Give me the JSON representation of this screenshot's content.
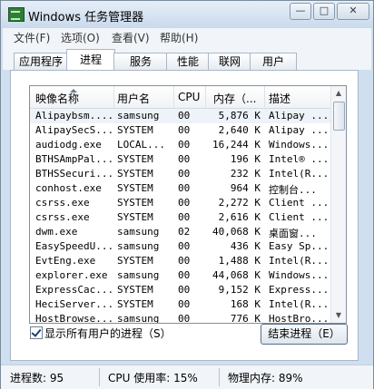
{
  "window": {
    "title": "Windows 任务管理器",
    "controls": {
      "minimize": "—",
      "maximize": "□",
      "close": "✕"
    }
  },
  "menu": [
    "文件(F)",
    "选项(O)",
    "查看(V)",
    "帮助(H)"
  ],
  "tabs": [
    {
      "label": "应用程序",
      "active": false
    },
    {
      "label": "进程",
      "active": true
    },
    {
      "label": "服务",
      "active": false
    },
    {
      "label": "性能",
      "active": false
    },
    {
      "label": "联网",
      "active": false
    },
    {
      "label": "用户",
      "active": false
    }
  ],
  "table": {
    "columns": [
      "映像名称",
      "用户名",
      "CPU",
      "内存（...",
      "描述"
    ],
    "rows": [
      [
        "Alipaybsm....",
        "samsung",
        "00",
        "5,876 K",
        "Alipay ..."
      ],
      [
        "AlipaySecS...",
        "SYSTEM",
        "00",
        "2,640 K",
        "Alipay ..."
      ],
      [
        "audiodg.exe",
        "LOCAL...",
        "00",
        "16,244 K",
        "Windows..."
      ],
      [
        "BTHSAmpPal...",
        "SYSTEM",
        "00",
        "196 K",
        "Intel® ..."
      ],
      [
        "BTHSSecuri...",
        "SYSTEM",
        "00",
        "232 K",
        "Intel(R..."
      ],
      [
        "conhost.exe",
        "SYSTEM",
        "00",
        "964 K",
        "控制台..."
      ],
      [
        "csrss.exe",
        "SYSTEM",
        "00",
        "2,272 K",
        "Client ..."
      ],
      [
        "csrss.exe",
        "SYSTEM",
        "00",
        "2,616 K",
        "Client ..."
      ],
      [
        "dwm.exe",
        "samsung",
        "02",
        "40,068 K",
        "桌面窗..."
      ],
      [
        "EasySpeedU...",
        "samsung",
        "00",
        "436 K",
        "Easy Sp..."
      ],
      [
        "EvtEng.exe",
        "SYSTEM",
        "00",
        "1,488 K",
        "Intel(R..."
      ],
      [
        "explorer.exe",
        "samsung",
        "00",
        "44,068 K",
        "Windows..."
      ],
      [
        "ExpressCac...",
        "SYSTEM",
        "00",
        "9,152 K",
        "Express..."
      ],
      [
        "HeciServer...",
        "SYSTEM",
        "00",
        "168 K",
        "Intel(R..."
      ],
      [
        "HostBrowse...",
        "samsung",
        "00",
        "776 K",
        "HostBro..."
      ]
    ]
  },
  "show_all_users": {
    "label": "显示所有用户的进程（S）",
    "checked": true
  },
  "end_process_label": "结束进程（E）",
  "status": {
    "processes": "进程数: 95",
    "cpu": "CPU 使用率: 15%",
    "memory": "物理内存: 89%"
  }
}
